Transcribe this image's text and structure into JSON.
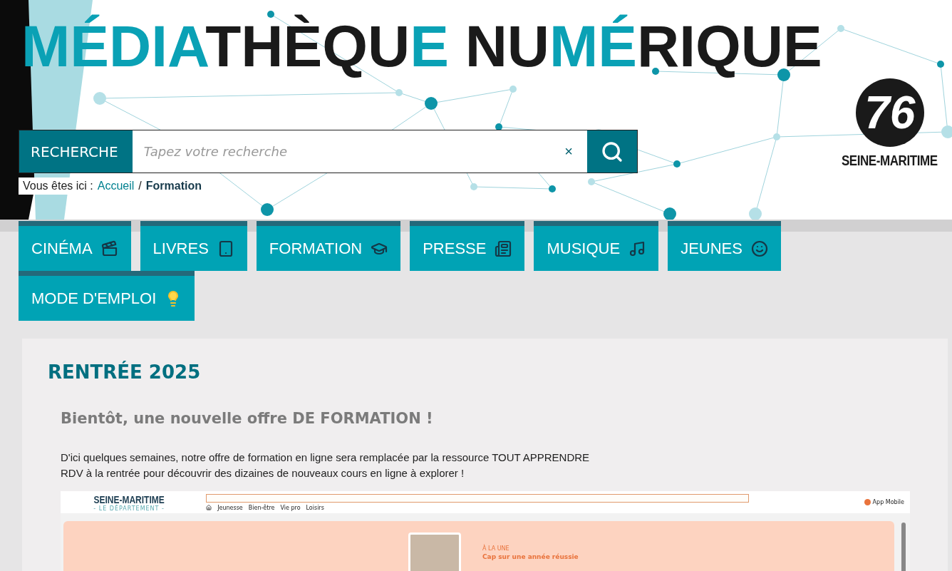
{
  "header": {
    "title": [
      {
        "text": "MÉDIA",
        "accent": true
      },
      {
        "text": "THÈQU",
        "accent": false
      },
      {
        "text": "E",
        "accent": true
      },
      {
        "text": " NU",
        "accent": false
      },
      {
        "text": "MÉ",
        "accent": true
      },
      {
        "text": "RIQUE",
        "accent": false
      }
    ],
    "logo": {
      "number": "76",
      "name": "SEINE-MARITIME"
    },
    "search": {
      "label": "RECHERCHE",
      "placeholder": "Tapez votre recherche",
      "clear": "×"
    },
    "breadcrumb": {
      "prefix": "Vous êtes ici :",
      "items": [
        {
          "label": "Accueil",
          "current": false
        },
        {
          "label": "Formation",
          "current": true
        }
      ],
      "separator": "/"
    }
  },
  "nav": [
    {
      "label": "CINÉMA",
      "kind": "film"
    },
    {
      "label": "LIVRES",
      "kind": "book"
    },
    {
      "label": "FORMATION",
      "kind": "school"
    },
    {
      "label": "PRESSE",
      "kind": "press"
    },
    {
      "label": "MUSIQUE",
      "kind": "music"
    },
    {
      "label": "JEUNES",
      "kind": "youth"
    },
    {
      "label": "MODE D'EMPLOI",
      "kind": "help"
    }
  ],
  "article": {
    "title": "RENTRÉE 2025",
    "subtitle": "Bientôt, une nouvelle offre **DE FORMATION !**",
    "paragraphs": [
      "D'ici quelques semaines, notre offre de formation en ligne sera remplacée par la ressource TOUT APPRENDRE",
      "RDV à la rentrée pour découvrir des dizaines de nouveaux cours en ligne à explorer !"
    ],
    "embed": {
      "brand": "SEINE-MARITIME",
      "brand_sub": "- LE DÉPARTEMENT -",
      "menu": [
        "Jeunesse",
        "Bien-être",
        "Vie pro",
        "Loisirs"
      ],
      "links": [
        "App Mobile"
      ],
      "hero_kicker": "À LA UNE",
      "hero_title": "Cap sur une année réussie"
    }
  }
}
